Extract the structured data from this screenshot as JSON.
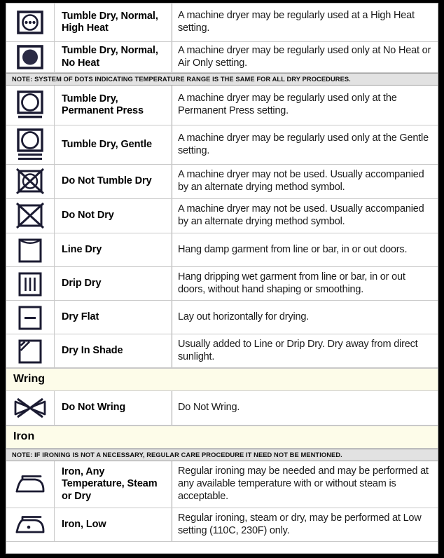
{
  "meta": {
    "title": "Laundry Care Symbols - Dry, Wring and Iron",
    "colors": {
      "page_border": "#000000",
      "sheet_background": "#ffffff",
      "grid_line": "#c9c9c9",
      "note_background": "#e2e2e2",
      "section_background": "#fdfce9",
      "symbol_ink": "#1b1b32",
      "text": "#111111"
    }
  },
  "rows": [
    {
      "kind": "entry",
      "icon": "tumble-dry-normal-high-heat-icon",
      "label": "Tumble Dry, Normal, High Heat",
      "description": "A machine dryer may be regularly used at a High Heat setting."
    },
    {
      "kind": "entry",
      "icon": "tumble-dry-normal-no-heat-icon",
      "label": "Tumble Dry, Normal, No Heat",
      "description": "A machine dryer may be regularly used only at No Heat or Air Only setting."
    },
    {
      "kind": "note",
      "icon": "note-marker",
      "text": "NOTE: SYSTEM OF DOTS INDICATING TEMPERATURE RANGE IS THE SAME FOR ALL DRY PROCEDURES."
    },
    {
      "kind": "entry",
      "icon": "tumble-dry-permanent-press-icon",
      "label": "Tumble Dry, Permanent Press",
      "description": "A machine dryer may be regularly used only at the Permanent Press setting."
    },
    {
      "kind": "entry",
      "icon": "tumble-dry-gentle-icon",
      "label": "Tumble Dry, Gentle",
      "description": "A machine dryer may be regularly used only at the Gentle setting."
    },
    {
      "kind": "entry",
      "icon": "do-not-tumble-dry-icon",
      "label": "Do Not Tumble Dry",
      "description": "A machine dryer may not be used. Usually accompanied by an alternate drying method symbol."
    },
    {
      "kind": "entry",
      "icon": "do-not-dry-icon",
      "label": "Do Not Dry",
      "description": "A machine dryer may not be used. Usually accompanied by an alternate drying method symbol."
    },
    {
      "kind": "entry",
      "icon": "line-dry-icon",
      "label": "Line Dry",
      "description": "Hang damp garment from line or bar, in or out doors."
    },
    {
      "kind": "entry",
      "icon": "drip-dry-icon",
      "label": "Drip Dry",
      "description": "Hang dripping wet garment from line or bar, in or out doors, without hand shaping or smoothing."
    },
    {
      "kind": "entry",
      "icon": "dry-flat-icon",
      "label": "Dry Flat",
      "description": "Lay out horizontally for drying."
    },
    {
      "kind": "entry",
      "icon": "dry-in-shade-icon",
      "label": "Dry In Shade",
      "description": "Usually added to Line or Drip Dry. Dry away from direct sunlight."
    },
    {
      "kind": "section",
      "icon": "section-heading",
      "title": "Wring"
    },
    {
      "kind": "entry",
      "icon": "do-not-wring-icon",
      "label": "Do Not Wring",
      "description": "Do Not Wring."
    },
    {
      "kind": "section",
      "icon": "section-heading",
      "title": "Iron"
    },
    {
      "kind": "note",
      "icon": "note-marker",
      "text": "NOTE: IF IRONING IS NOT A NECESSARY, REGULAR CARE PROCEDURE IT NEED NOT BE MENTIONED."
    },
    {
      "kind": "entry",
      "icon": "iron-any-temperature-icon",
      "label": "Iron, Any Temperature, Steam or Dry",
      "description": "Regular ironing may be needed and may be performed at any available temperature with or without steam is acceptable."
    },
    {
      "kind": "entry",
      "icon": "iron-low-icon",
      "label": "Iron, Low",
      "description": "Regular ironing, steam or dry, may be performed at Low setting (110C, 230F) only."
    }
  ]
}
